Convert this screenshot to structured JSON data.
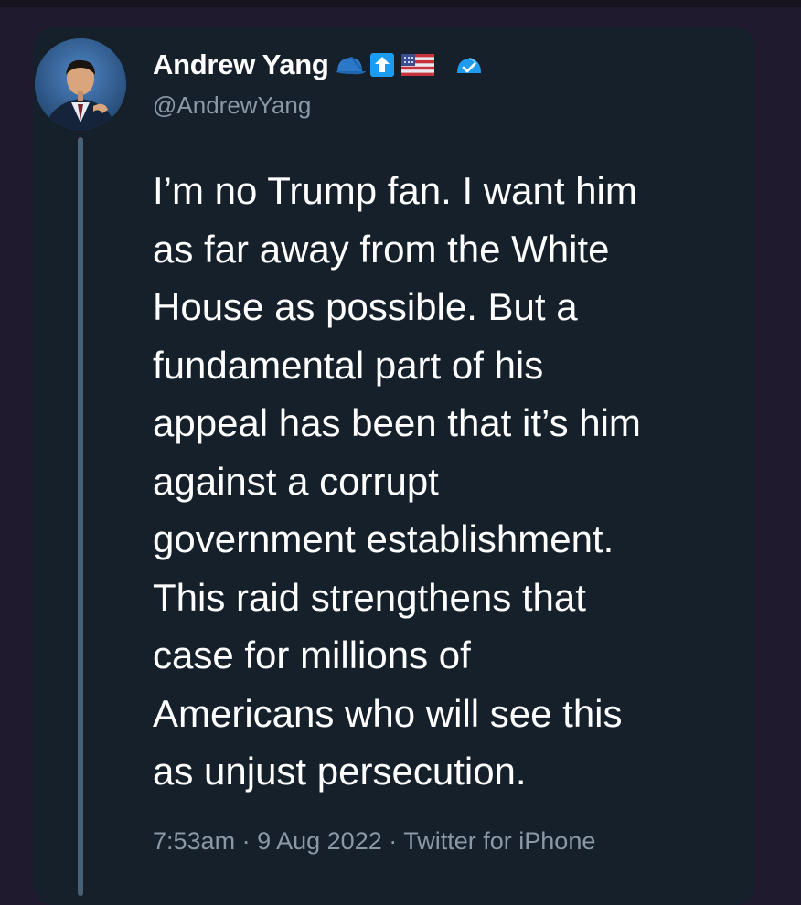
{
  "tweet": {
    "author": {
      "display_name": "Andrew Yang",
      "name_emojis": [
        "blue-cap-icon",
        "up-arrow-icon",
        "us-flag-icon",
        "verified-badge-icon"
      ],
      "handle": "@AndrewYang"
    },
    "lines": [
      "I’m no Trump fan. I want him",
      "as far away from the White",
      "House as possible. But a",
      "fundamental part of his",
      "appeal has been that it’s him",
      "against a corrupt",
      "government establishment.",
      "This raid strengthens that",
      "case for millions of",
      "Americans who will see this",
      "as unjust persecution."
    ],
    "meta": {
      "time": "7:53am",
      "separator": "·",
      "date": "9 Aug 2022",
      "source": "Twitter for iPhone"
    }
  },
  "colors": {
    "page_background": "#1f1a2e",
    "card_background": "#16202b",
    "text_primary": "#ffffff",
    "text_secondary": "#8b98a5",
    "thread_line": "#4a6075",
    "cap_blue": "#2a78c7",
    "arrow_blue": "#1d9bf0"
  }
}
